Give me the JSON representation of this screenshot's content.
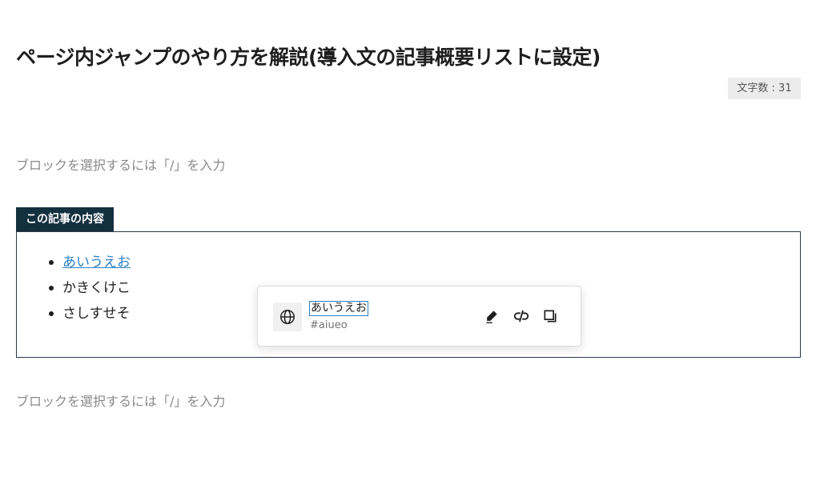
{
  "post": {
    "title": "ページ内ジャンプのやり方を解説(導入文の記事概要リストに設定)",
    "char_count": "文字数 : 31"
  },
  "placeholders": {
    "first": "ブロックを選択するには「/」を入力",
    "second": "ブロックを選択するには「/」を入力"
  },
  "toc": {
    "heading": "この記事の内容",
    "items": [
      {
        "label": "あいうえお",
        "linked": true
      },
      {
        "label": "かきくけこ",
        "linked": false
      },
      {
        "label": "さしすせそ",
        "linked": false
      }
    ]
  },
  "link_popover": {
    "text": "あいうえお",
    "url": "#aiueo",
    "icons": [
      "globe-icon",
      "pencil-icon",
      "unlink-icon",
      "copy-icon"
    ]
  },
  "colors": {
    "toc_heading_bg": "#13303f",
    "link": "#2b7fc4"
  }
}
